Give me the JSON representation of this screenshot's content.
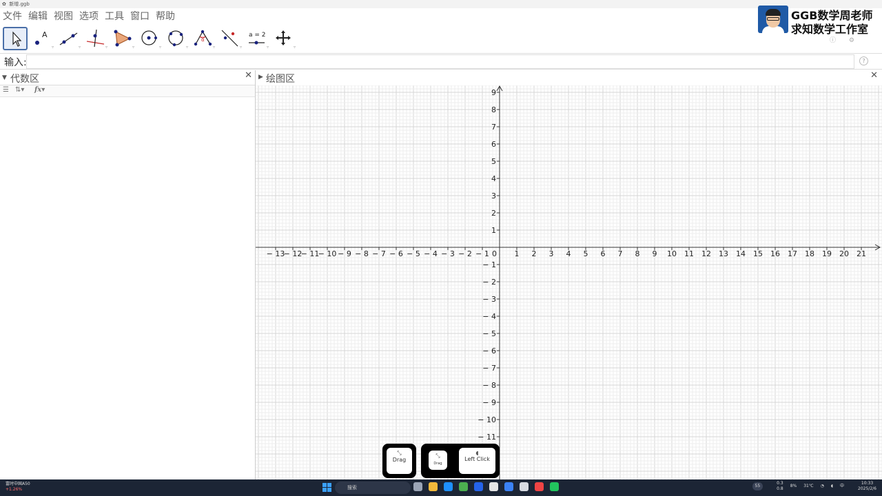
{
  "window": {
    "title": "新增.ggb"
  },
  "menu": {
    "items": [
      "文件",
      "编辑",
      "视图",
      "选项",
      "工具",
      "窗口",
      "帮助"
    ]
  },
  "brand": {
    "line1": "GGB数学周老师",
    "line2": "求知数学工作室"
  },
  "toolbar": {
    "tools": [
      "move-tool-icon",
      "point-tool-icon",
      "line-tool-icon",
      "perpendicular-tool-icon",
      "polygon-tool-icon",
      "circle-center-tool-icon",
      "circle-three-points-tool-icon",
      "angle-tool-icon",
      "reflect-tool-icon",
      "slider-tool-icon",
      "move-view-tool-icon"
    ],
    "slider_label": "a = 2"
  },
  "input": {
    "label": "输入:",
    "value": ""
  },
  "algebra": {
    "title": "代数区"
  },
  "graphics": {
    "title": "绘图区"
  },
  "axes": {
    "x_min": -13,
    "x_max": 21,
    "y_min": -11,
    "y_max": 9,
    "x_ticks": [
      "-13",
      "-12",
      "-11",
      "-10",
      "-9",
      "-8",
      "-7",
      "-6",
      "-5",
      "-4",
      "-3",
      "-2",
      "-1",
      "1",
      "2",
      "3",
      "4",
      "5",
      "6",
      "7",
      "8",
      "9",
      "10",
      "11",
      "12",
      "13",
      "14",
      "15",
      "16",
      "17",
      "18",
      "19",
      "20",
      "21"
    ],
    "y_ticks": [
      "9",
      "8",
      "7",
      "6",
      "5",
      "4",
      "3",
      "2",
      "1",
      "-1",
      "-2",
      "-3",
      "-4",
      "-5",
      "-6",
      "-7",
      "-8",
      "-9",
      "-10",
      "-11"
    ],
    "origin_label": "0"
  },
  "overlay": {
    "drag1": "Drag",
    "drag2": "Drag",
    "click": "Left Click"
  },
  "taskbar": {
    "stock_name": "富时中国A50",
    "stock_change": "+1.26%",
    "search": "搜索",
    "temp": "31℃",
    "cpu": "8%",
    "time": "10:33",
    "date": "2025/2/6",
    "ime": "中",
    "net_up": "0.3",
    "net_down": "0.8",
    "badge": "55"
  }
}
